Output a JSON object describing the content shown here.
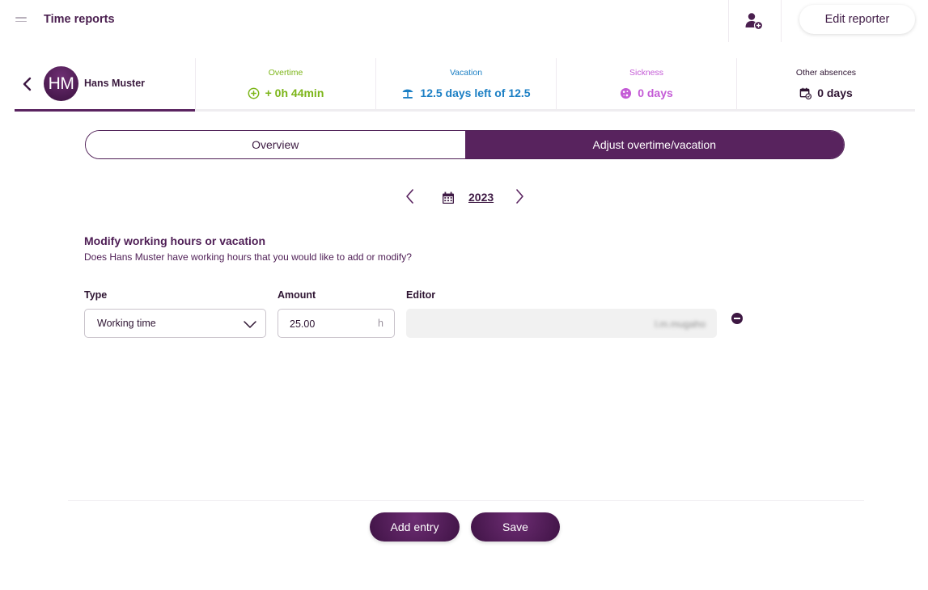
{
  "header": {
    "title": "Time reports",
    "edit_reporter_label": "Edit reporter"
  },
  "user": {
    "initials": "HM",
    "name": "Hans Muster"
  },
  "stats": {
    "overtime": {
      "label": "Overtime",
      "value": "+ 0h 44min",
      "color": "#7cb518"
    },
    "vacation": {
      "label": "Vacation",
      "value": "12.5 days left of 12.5",
      "color": "#1b7fc4"
    },
    "sickness": {
      "label": "Sickness",
      "value": "0 days",
      "color": "#c45bd6"
    },
    "other": {
      "label": "Other absences",
      "value": "0 days",
      "color": "#2e1432"
    }
  },
  "tabs": [
    {
      "label": "Overview",
      "active": false
    },
    {
      "label": "Adjust overtime/vacation",
      "active": true
    }
  ],
  "year_nav": {
    "year": "2023"
  },
  "section": {
    "title": "Modify working hours or vacation",
    "description": "Does Hans Muster have working hours that you would like to add or modify?"
  },
  "form": {
    "type_label": "Type",
    "amount_label": "Amount",
    "editor_label": "Editor",
    "type_value": "Working time",
    "amount_value": "25.00",
    "amount_unit": "h",
    "editor_value": "l.m.mugaho"
  },
  "footer": {
    "add_entry_label": "Add entry",
    "save_label": "Save"
  },
  "colors": {
    "brand": "#58235e",
    "overtime": "#7cb518",
    "vacation": "#1b7fc4",
    "sickness": "#c45bd6"
  }
}
